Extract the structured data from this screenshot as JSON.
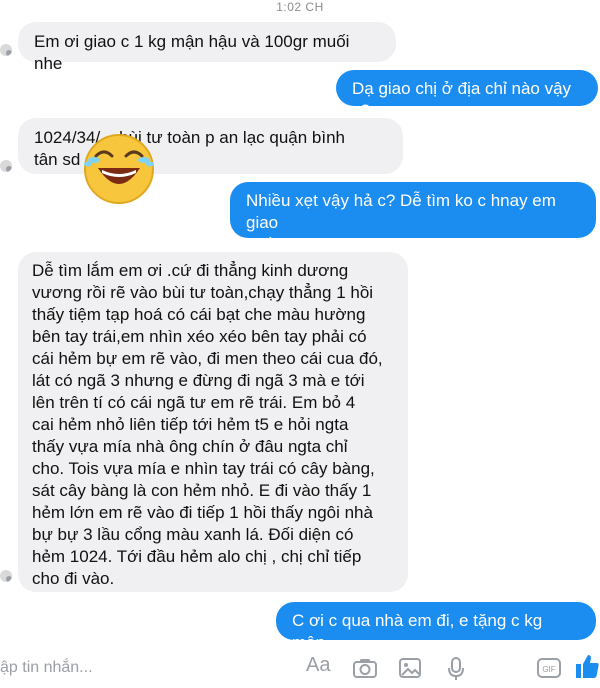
{
  "status_bar": {
    "time": "1:02 CH"
  },
  "messages": [
    {
      "text": "Em ơi giao c 1 kg mận hậu và 100gr muối nhe"
    },
    {
      "text": "Dạ giao chị ở địa chỉ nào vậy c?"
    },
    {
      "text": "1024/34/... bùi tư toàn p an lạc quận bình\ntân sd ...590"
    },
    {
      "text": "Nhiều xẹt vậy hả c? Dễ tìm ko c hnay em giao\nnhiều sợ khó shipper tìm ko ra"
    },
    {
      "text": "Dễ tìm lắm em ơi .cứ đi thẳng kinh dương\nvương rồi rẽ vào bùi tư toàn,chạy thẳng 1 hồi\nthấy tiệm tạp hoá có cái bạt che màu hường\nbên tay trái,em nhìn xéo xéo bên tay phải có\ncái hẻm bự em rẽ vào, đi men theo cái cua đó,\nlát có ngã 3 nhưng e đừng đi ngã 3 mà e tới\nlên trên tí có cái ngã tư em rẽ trái. Em bỏ 4\ncai hẻm nhỏ liên tiếp tới hẻm t5 e hỏi ngta\nthấy vựa mía nhà ông chín ở đâu ngta chỉ\ncho. Tois vựa mía e nhìn tay trái có cây bàng,\nsát cây bàng là con hẻm nhỏ. E đi vào thấy 1\nhẻm lớn em rẽ vào đi tiếp 1 hồi thấy ngôi nhà\nbự bự 3 lầu cổng màu xanh lá. Đối diện có\nhẻm 1024. Tới đầu hẻm alo chị , chị chỉ tiếp\ncho đi vào."
    },
    {
      "text": "C ơi c qua nhà em đi, e tặng c kg mận"
    }
  ],
  "composer": {
    "placeholder": "ập tin nhắn...",
    "aa_label": "Aa",
    "icons": [
      "camera-icon",
      "image-icon",
      "microphone-icon",
      "sticker-icon",
      "thumbs-up-icon"
    ]
  },
  "colors": {
    "outgoing_bubble": "#1b8cf0",
    "incoming_bubble": "#f0f0f2",
    "send_blue": "#1b8cf0"
  }
}
